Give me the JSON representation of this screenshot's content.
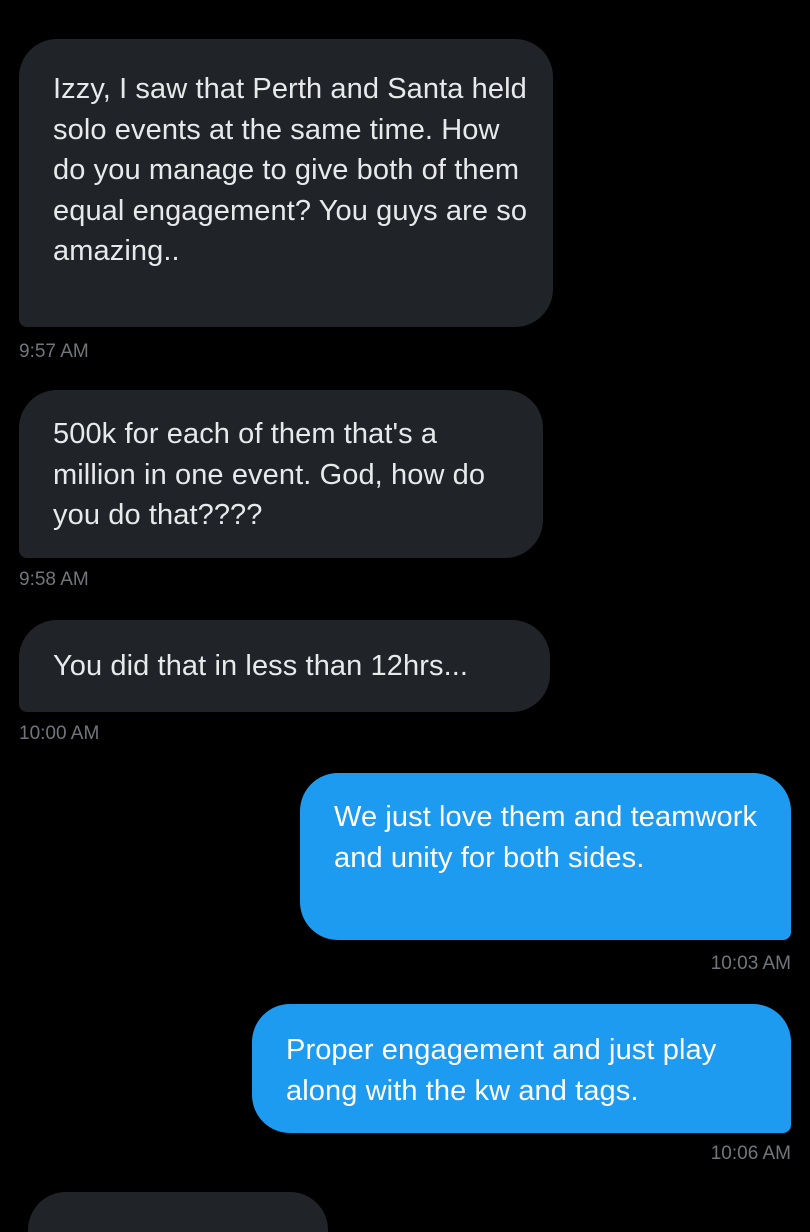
{
  "conversation": {
    "messages": [
      {
        "direction": "received",
        "text": "Izzy, I saw that Perth and Santa held solo events at the same time. How do you manage to give both of them equal engagement? You guys are so amazing..",
        "time": "9:57 AM"
      },
      {
        "direction": "received",
        "text": "500k for each of them that's a million in one event. God, how do you do that????",
        "time": "9:58 AM"
      },
      {
        "direction": "received",
        "text": "You did that in less than 12hrs...",
        "time": "10:00 AM"
      },
      {
        "direction": "sent",
        "text": "We just love them and teamwork and unity for both sides.",
        "time": "10:03 AM"
      },
      {
        "direction": "sent",
        "text": "Proper engagement and just play along with the kw and tags.",
        "time": "10:06 AM"
      }
    ]
  },
  "colors": {
    "background": "#000000",
    "received_bubble": "#202327",
    "sent_bubble": "#1d9bf0",
    "received_text": "#e7e9ea",
    "sent_text": "#ffffff",
    "timestamp": "#71767b"
  }
}
